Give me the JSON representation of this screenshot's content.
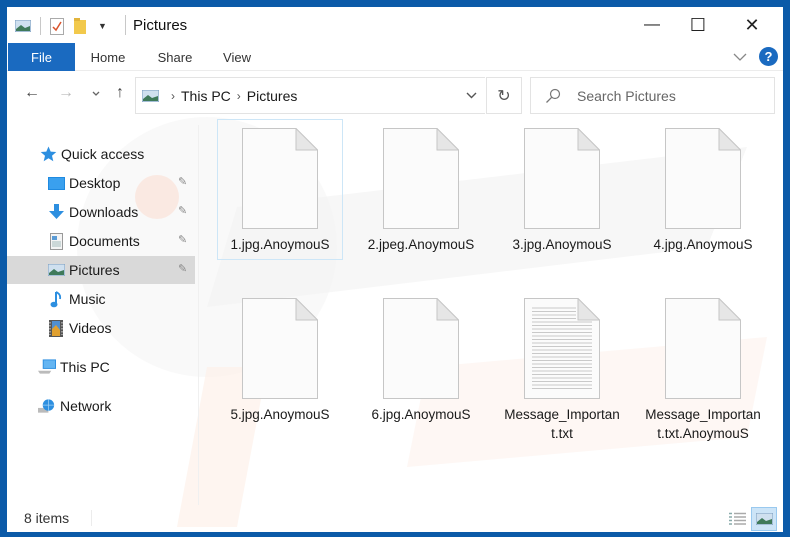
{
  "window": {
    "title": "Pictures",
    "controls": {
      "minimize": "—",
      "maximize": "☐",
      "close": "✕"
    }
  },
  "ribbon": {
    "tabs": [
      {
        "label": "File",
        "active": true
      },
      {
        "label": "Home"
      },
      {
        "label": "Share"
      },
      {
        "label": "View"
      }
    ],
    "help_label": "?",
    "accent_color": "#1a6ac0"
  },
  "navigation": {
    "back_icon": "←",
    "forward_icon": "→",
    "recent_icon": "⌄",
    "up_icon": "↑",
    "breadcrumb": [
      "This PC",
      "Pictures"
    ],
    "crumb_separator": "›",
    "dropdown_icon": "⌄",
    "refresh_icon": "↻",
    "search_placeholder": "Search Pictures",
    "search_icon": "⚲"
  },
  "sidebar": {
    "items": [
      {
        "label": "Quick access",
        "icon": "star-icon"
      },
      {
        "label": "Desktop",
        "icon": "desktop-icon",
        "pinned": true
      },
      {
        "label": "Downloads",
        "icon": "download-icon",
        "pinned": true
      },
      {
        "label": "Documents",
        "icon": "documents-icon",
        "pinned": true
      },
      {
        "label": "Pictures",
        "icon": "pictures-icon",
        "pinned": true,
        "selected": true
      },
      {
        "label": "Music",
        "icon": "music-icon"
      },
      {
        "label": "Videos",
        "icon": "videos-icon"
      },
      {
        "label": "This PC",
        "icon": "computer-icon"
      },
      {
        "label": "Network",
        "icon": "network-icon"
      }
    ],
    "pin_icon": "📌"
  },
  "files": [
    {
      "name": "1.jpg.AnoymouS",
      "type": "blank",
      "selected": true
    },
    {
      "name": "2.jpeg.AnoymouS",
      "type": "blank"
    },
    {
      "name": "3.jpg.AnoymouS",
      "type": "blank"
    },
    {
      "name": "4.jpg.AnoymouS",
      "type": "blank"
    },
    {
      "name": "5.jpg.AnoymouS",
      "type": "blank"
    },
    {
      "name": "6.jpg.AnoymouS",
      "type": "blank"
    },
    {
      "name": "Message_Important.txt",
      "type": "text"
    },
    {
      "name": "Message_Important.txt.AnoymouS",
      "type": "blank"
    }
  ],
  "status": {
    "item_count": "8 items"
  }
}
